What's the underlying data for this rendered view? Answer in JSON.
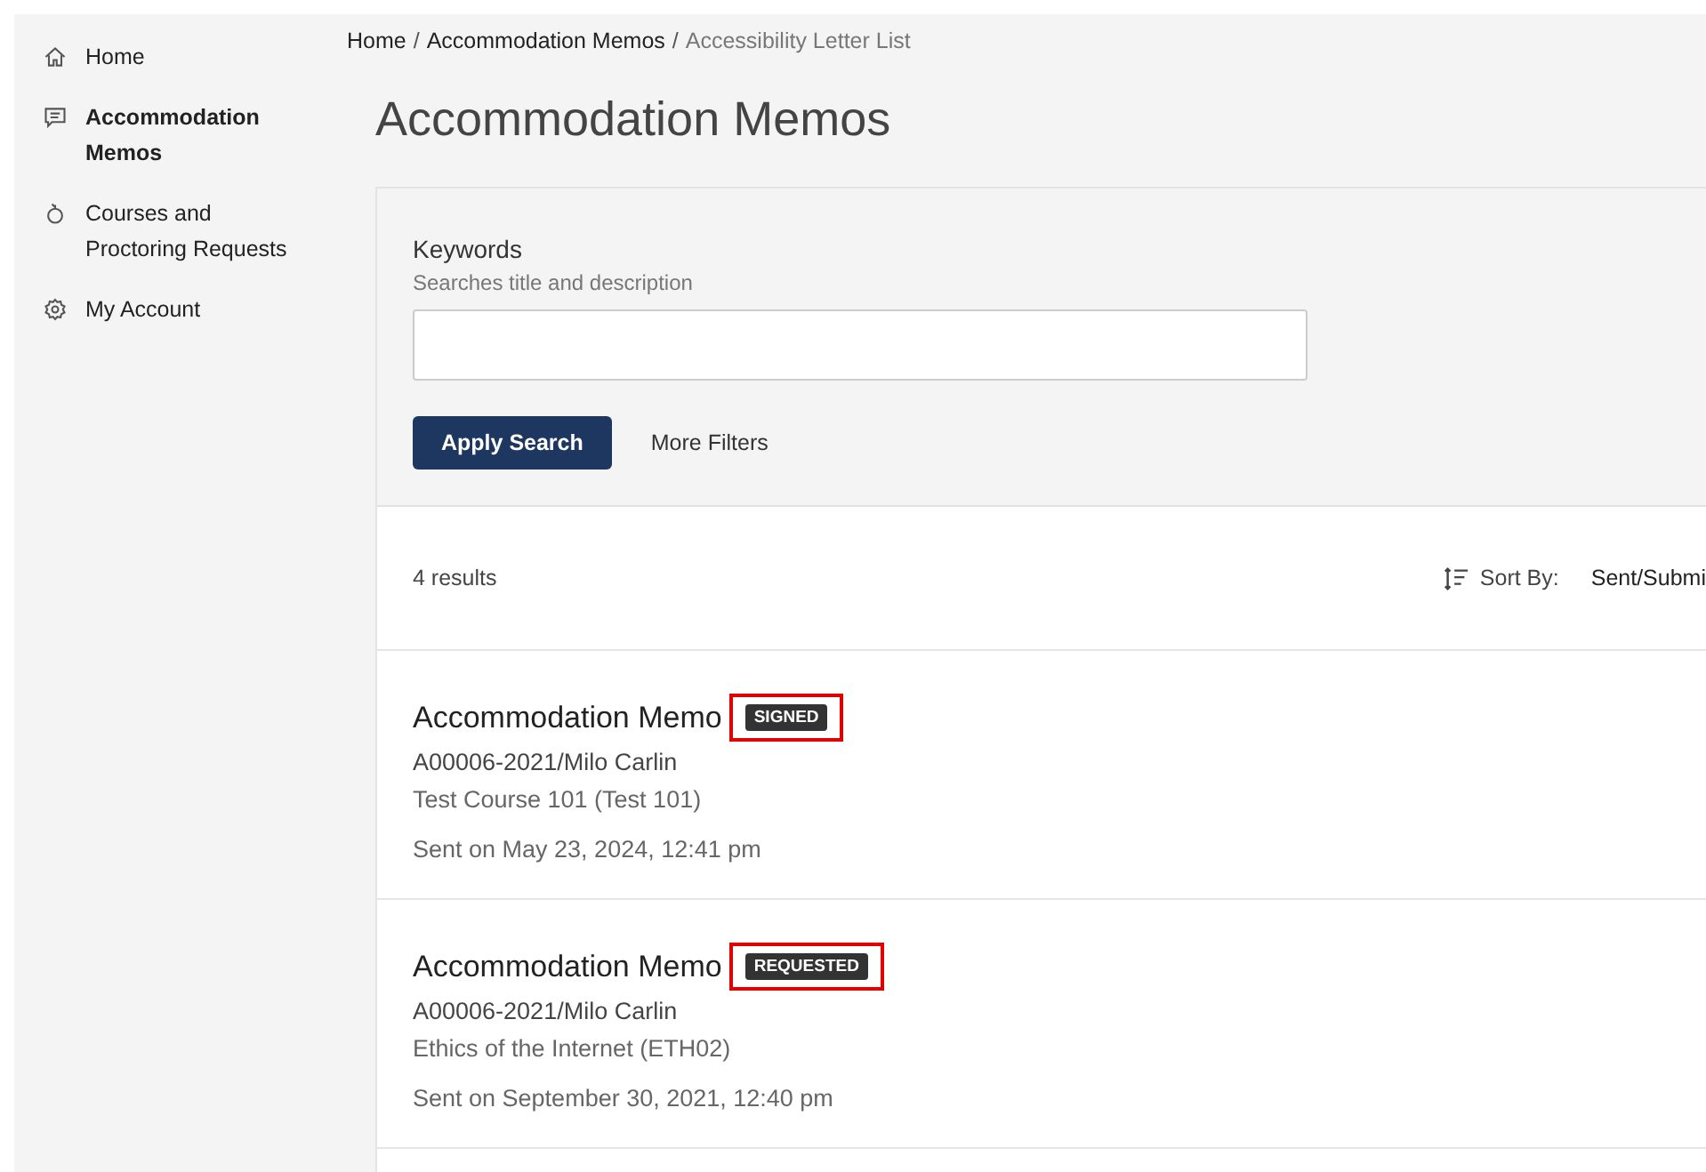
{
  "sidebar": {
    "items": [
      {
        "label": "Home",
        "selected": false
      },
      {
        "label": "Accommodation Memos",
        "selected": true
      },
      {
        "label": "Courses and Proctoring Requests",
        "selected": false
      },
      {
        "label": "My Account",
        "selected": false
      }
    ]
  },
  "breadcrumb": [
    {
      "kind": "link",
      "text": "Home"
    },
    {
      "kind": "separator",
      "text": "/"
    },
    {
      "kind": "link",
      "text": "Accommodation Memos"
    },
    {
      "kind": "separator",
      "text": "/"
    },
    {
      "kind": "current",
      "text": "Accessibility Letter List"
    }
  ],
  "title": "Accommodation Memos",
  "filters": {
    "label": "Keywords",
    "hint": "Searches title and description",
    "apply_button": "Apply Search",
    "more_button": "More Filters"
  },
  "results": {
    "count": "4 results",
    "sort_label": "Sort By:",
    "sort_value": "Sent/Submi",
    "items": [
      {
        "title": "Accommodation Memo",
        "status": "SIGNED",
        "highlighted": true,
        "reference": "A00006-2021/Milo Carlin",
        "course": "Test Course 101 (Test 101)",
        "sent": "Sent on May 23, 2024, 12:41 pm"
      },
      {
        "title": "Accommodation Memo",
        "status": "REQUESTED",
        "highlighted": true,
        "reference": "A00006-2021/Milo Carlin",
        "course": "Ethics of the Internet (ETH02)",
        "sent": "Sent on September 30, 2021, 12:40 pm"
      }
    ]
  }
}
